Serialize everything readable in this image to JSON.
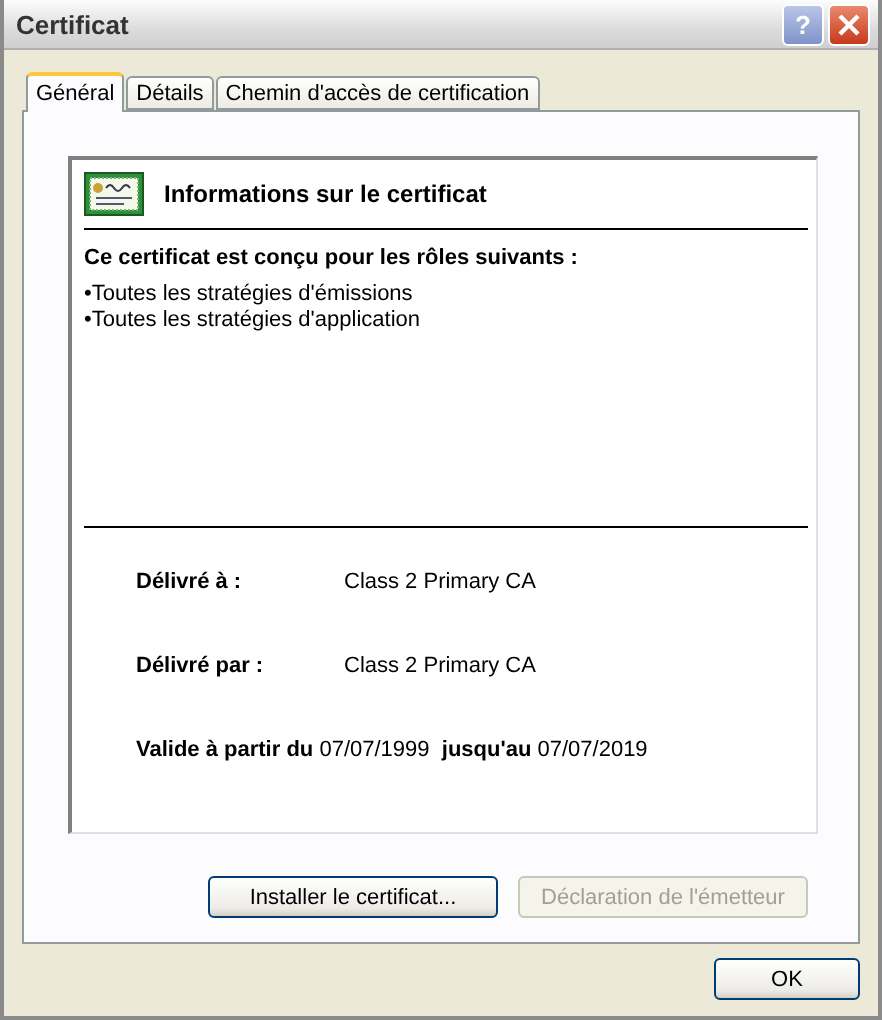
{
  "window": {
    "title": "Certificat",
    "help_button": "?"
  },
  "tabs": [
    {
      "label": "Général",
      "selected": true
    },
    {
      "label": "Détails",
      "selected": false
    },
    {
      "label": "Chemin d'accès de certification",
      "selected": false
    }
  ],
  "info": {
    "heading": "Informations sur le certificat",
    "purpose_title": "Ce certificat est conçu pour les rôles suivants :",
    "purposes": [
      "•Toutes les stratégies d'émissions",
      "•Toutes les stratégies d'application"
    ]
  },
  "fields": [
    {
      "label": "Délivré à :",
      "value": "Class 2 Primary CA"
    },
    {
      "label": "Délivré par :",
      "value": "Class 2 Primary CA"
    }
  ],
  "validity": {
    "from_label": "Valide à partir du",
    "from": "07/07/1999",
    "to_label": "jusqu'au",
    "to": "07/07/2019"
  },
  "buttons": [
    {
      "label": "Installer le certificat...",
      "disabled": false
    },
    {
      "label": "Déclaration de l'émetteur",
      "disabled": true
    }
  ],
  "ok_button": "OK"
}
